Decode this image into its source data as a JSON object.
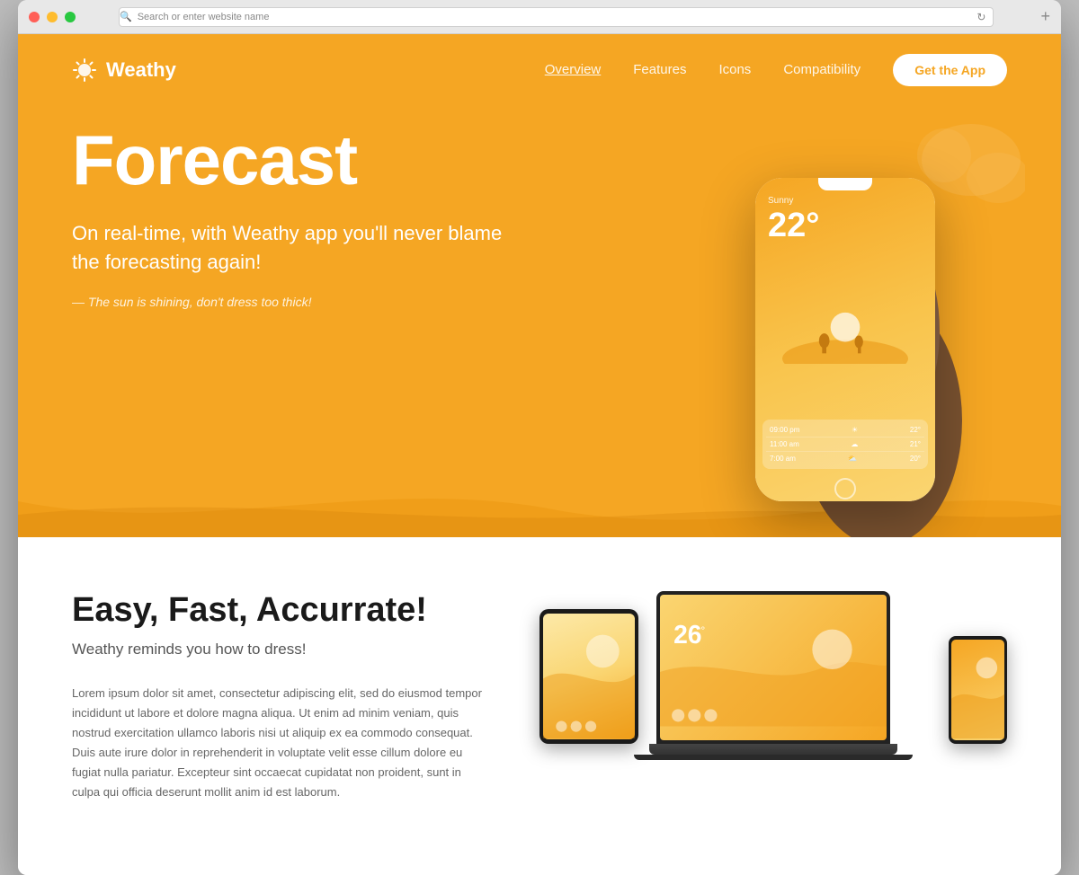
{
  "browser": {
    "address_placeholder": "Search or enter website name"
  },
  "nav": {
    "logo_text": "Weathy",
    "links": [
      {
        "label": "Overview",
        "active": true
      },
      {
        "label": "Features",
        "active": false
      },
      {
        "label": "Icons",
        "active": false
      },
      {
        "label": "Compatibility",
        "active": false
      }
    ],
    "cta_label": "Get the App"
  },
  "hero": {
    "title": "Forecast",
    "subtitle": "On real-time, with Weathy app you'll never blame the forecasting again!",
    "tagline": "— The sun is shining, don't dress too thick!",
    "weather": {
      "condition": "Sunny",
      "temperature": "22°",
      "rows": [
        {
          "time": "09:00 pm",
          "icon": "☀",
          "temp": "22°"
        },
        {
          "time": "11:00 am",
          "icon": "☁",
          "temp": "21°"
        },
        {
          "time": "7:00 am",
          "icon": "⛅",
          "temp": "20°"
        }
      ]
    }
  },
  "features": {
    "title": "Easy, Fast, Accurrate!",
    "subtitle": "Weathy reminds you how to dress!",
    "body": "Lorem ipsum dolor sit amet, consectetur adipiscing elit, sed do eiusmod tempor incididunt ut labore et dolore magna aliqua. Ut enim ad minim veniam, quis nostrud exercitation ullamco laboris nisi ut aliquip ex ea commodo consequat. Duis aute irure dolor in reprehenderit in voluptate velit esse cillum dolore eu fugiat nulla pariatur. Excepteur sint occaecat cupidatat non proident, sunt in culpa qui officia deserunt mollit anim id est laborum.",
    "device_temp": "26"
  },
  "colors": {
    "primary": "#F5A623",
    "primary_dark": "#e69510",
    "white": "#ffffff",
    "text_dark": "#1a1a1a",
    "text_mid": "#555555",
    "text_light": "#666666"
  }
}
